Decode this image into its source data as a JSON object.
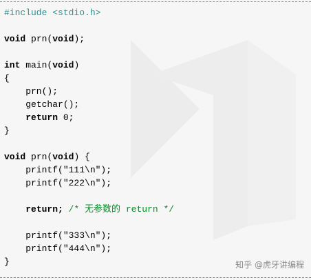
{
  "code": {
    "line1": "#include <stdio.h>",
    "line3_type": "void",
    "line3_name": " prn(",
    "line3_arg": "void",
    "line3_end": ");",
    "line5_type": "int",
    "line5_name": " main(",
    "line5_arg": "void",
    "line5_end": ")",
    "line6": "{",
    "line7": "    prn();",
    "line8": "    getchar();",
    "line9_kw": "return",
    "line9_rest": " 0;",
    "line10": "}",
    "line12_type": "void",
    "line12_name": " prn(",
    "line12_arg": "void",
    "line12_end": ") {",
    "line13": "    printf(\"111\\n\");",
    "line14": "    printf(\"222\\n\");",
    "line16_kw": "return",
    "line16_semi": ";",
    "line16_comment": " /* 无参数的 return */",
    "line18": "    printf(\"333\\n\");",
    "line19": "    printf(\"444\\n\");",
    "line20": "}"
  },
  "watermark": {
    "credit": "知乎 @虎牙讲编程"
  },
  "colors": {
    "preprocessor": "#2f8f8f",
    "comment": "#0b8a2a",
    "background": "#f6f6f6"
  }
}
